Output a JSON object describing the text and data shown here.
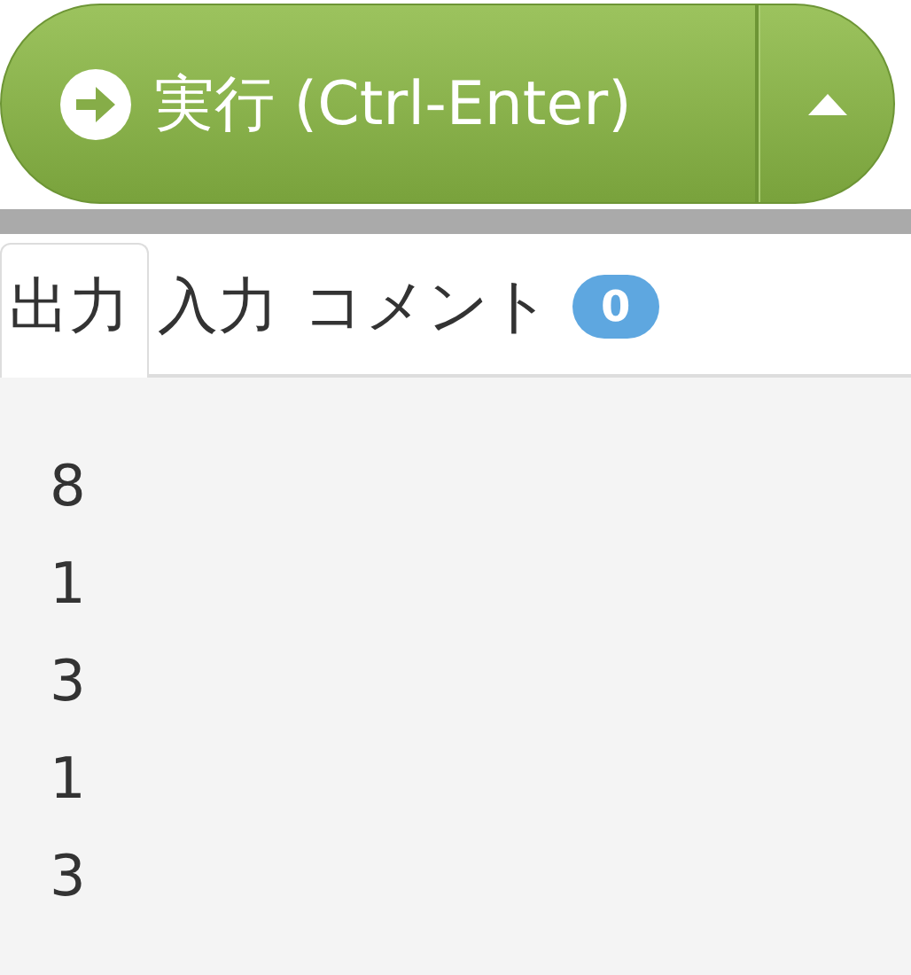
{
  "run_button": {
    "label": "実行 (Ctrl-Enter)"
  },
  "tabs": [
    {
      "label": "出力",
      "selected": true
    },
    {
      "label": "入力",
      "selected": false
    },
    {
      "label": "コメント",
      "selected": false,
      "badge": "0"
    }
  ],
  "output": [
    "8",
    "1",
    "3",
    "1",
    "3"
  ]
}
